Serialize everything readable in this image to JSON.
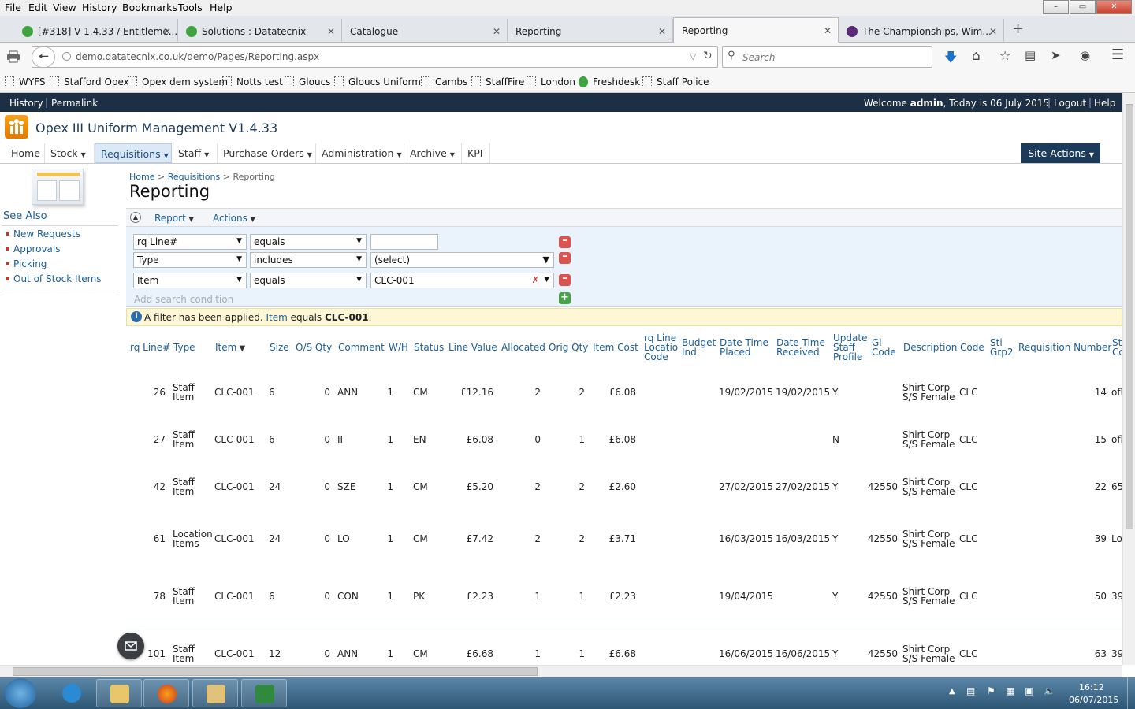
{
  "browser": {
    "menu": [
      "File",
      "Edit",
      "View",
      "History",
      "Bookmarks",
      "Tools",
      "Help"
    ],
    "tabs": [
      {
        "label": "[#318] V 1.4.33 / Entitleme...",
        "icon": "green-icon"
      },
      {
        "label": "Solutions : Datatecnix",
        "icon": "green-icon"
      },
      {
        "label": "Catalogue",
        "icon": ""
      },
      {
        "label": "Reporting",
        "icon": ""
      },
      {
        "label": "Reporting",
        "icon": "",
        "active": true
      },
      {
        "label": "The Championships, Wim...",
        "icon": "wimbledon-icon"
      }
    ],
    "new_tab": "+",
    "url": "demo.datatecnix.co.uk/demo/Pages/Reporting.aspx",
    "search_placeholder": "Search",
    "bookmarks": [
      "WYFS",
      "Stafford Opex",
      "Opex dem system",
      "Notts test",
      "Gloucs",
      "Gloucs Uniform",
      "Cambs",
      "StaffFire",
      "London",
      "Freshdesk",
      "Staff Police"
    ]
  },
  "app": {
    "top_left": {
      "history": "History",
      "permalink": "Permalink"
    },
    "welcome_prefix": "Welcome ",
    "user": "admin",
    "welcome_suffix": ", Today is 06 July 2015",
    "logout": "Logout",
    "help": "Help",
    "title": "Opex III Uniform Management V1.4.33",
    "nav": [
      "Home",
      "Stock",
      "Requisitions",
      "Staff",
      "Purchase Orders",
      "Administration",
      "Archive",
      "KPI"
    ],
    "site_actions": "Site Actions",
    "breadcrumb": [
      "Home",
      "Requisitions",
      "Reporting"
    ],
    "page_title": "Reporting",
    "see_also": {
      "title": "See Also",
      "links": [
        "New Requests",
        "Approvals",
        "Picking",
        "Out of Stock Items"
      ]
    },
    "toolbar": {
      "report": "Report",
      "actions": "Actions"
    },
    "criteria": [
      {
        "field": "rq Line#",
        "op": "equals",
        "value": ""
      },
      {
        "field": "Type",
        "op": "includes",
        "value": "(select)"
      },
      {
        "field": "Item",
        "op": "equals",
        "value": "CLC-001"
      }
    ],
    "add_condition": "Add search condition",
    "notice": {
      "text": "A filter has been applied. ",
      "field": "Item",
      "op": " equals ",
      "value": "CLC-001",
      "end": "."
    },
    "columns": [
      "rq Line#",
      "Type",
      "Item",
      "Size",
      "O/S Qty",
      "Comment",
      "W/H",
      "Status",
      "Line Value",
      "Allocated",
      "Orig Qty",
      "Item Cost",
      "rq Line Locatio Code",
      "Budget Ind",
      "Date Time Placed",
      "Date Time Received",
      "Update Staff Profile",
      "Gl Code",
      "Description",
      "Code",
      "Sti Grp2",
      "Requisition Number",
      "St Co"
    ],
    "rows": [
      {
        "line": "26",
        "type": "Staff Item",
        "item": "CLC-001",
        "size": "6",
        "os": "0",
        "comment": "ANN",
        "wh": "1",
        "status": "CM",
        "value": "£12.16",
        "alloc": "2",
        "orig": "2",
        "cost": "£6.08",
        "placed": "19/02/2015",
        "received": "19/02/2015",
        "update": "Y",
        "gl": "",
        "desc": "Shirt Corp S/S Female",
        "code": "CLC",
        "req": "14",
        "st": "ofl"
      },
      {
        "line": "27",
        "type": "Staff Item",
        "item": "CLC-001",
        "size": "6",
        "os": "0",
        "comment": "II",
        "wh": "1",
        "status": "EN",
        "value": "£6.08",
        "alloc": "0",
        "orig": "1",
        "cost": "£6.08",
        "placed": "",
        "received": "",
        "update": "N",
        "gl": "",
        "desc": "Shirt Corp S/S Female",
        "code": "CLC",
        "req": "15",
        "st": "ofl"
      },
      {
        "line": "42",
        "type": "Staff Item",
        "item": "CLC-001",
        "size": "24",
        "os": "0",
        "comment": "SZE",
        "wh": "1",
        "status": "CM",
        "value": "£5.20",
        "alloc": "2",
        "orig": "2",
        "cost": "£2.60",
        "placed": "27/02/2015",
        "received": "27/02/2015",
        "update": "Y",
        "gl": "42550",
        "desc": "Shirt Corp S/S Female",
        "code": "CLC",
        "req": "22",
        "st": "65"
      },
      {
        "line": "61",
        "type": "Location Items",
        "item": "CLC-001",
        "size": "24",
        "os": "0",
        "comment": "LO",
        "wh": "1",
        "status": "CM",
        "value": "£7.42",
        "alloc": "2",
        "orig": "2",
        "cost": "£3.71",
        "placed": "16/03/2015",
        "received": "16/03/2015",
        "update": "Y",
        "gl": "42550",
        "desc": "Shirt Corp S/S Female",
        "code": "CLC",
        "req": "39",
        "st": "Lo"
      },
      {
        "line": "78",
        "type": "Staff Item",
        "item": "CLC-001",
        "size": "6",
        "os": "0",
        "comment": "CON",
        "wh": "1",
        "status": "PK",
        "value": "£2.23",
        "alloc": "1",
        "orig": "1",
        "cost": "£2.23",
        "placed": "19/04/2015",
        "received": "",
        "update": "Y",
        "gl": "42550",
        "desc": "Shirt Corp S/S Female",
        "code": "CLC",
        "req": "50",
        "st": "39"
      },
      {
        "line": "101",
        "type": "Staff Item",
        "item": "CLC-001",
        "size": "12",
        "os": "0",
        "comment": "ANN",
        "wh": "1",
        "status": "CM",
        "value": "£6.68",
        "alloc": "1",
        "orig": "1",
        "cost": "£6.68",
        "placed": "16/06/2015",
        "received": "16/06/2015",
        "update": "Y",
        "gl": "42550",
        "desc": "Shirt Corp S/S Female",
        "code": "CLC",
        "req": "63",
        "st": "39"
      }
    ]
  },
  "taskbar": {
    "time": "16:12",
    "date": "06/07/2015"
  }
}
